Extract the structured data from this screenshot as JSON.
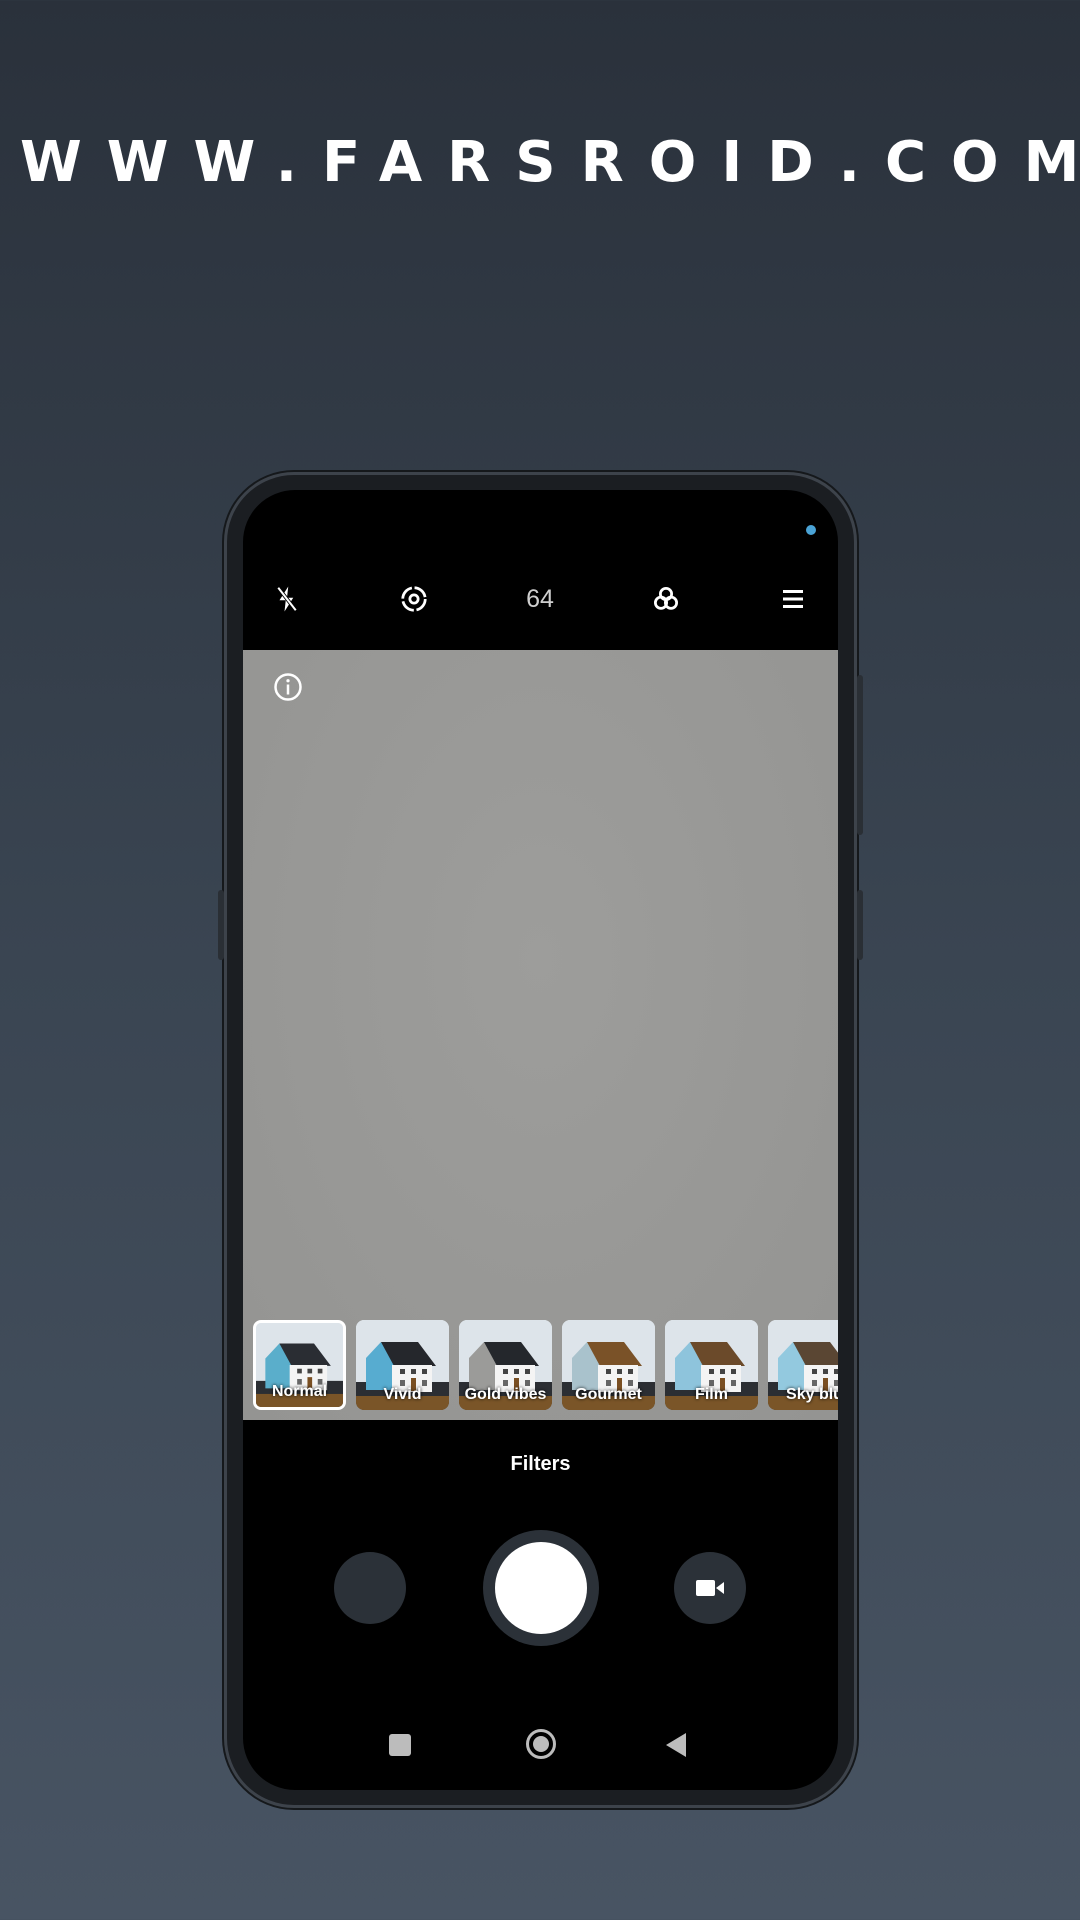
{
  "watermark": "WWW.FARSROID.COM",
  "topbar": {
    "flash_icon": "flash-off-icon",
    "hdr_icon": "lens-icon",
    "megapixels": "64",
    "filters_icon": "filters-icon",
    "menu_icon": "menu-icon"
  },
  "viewfinder": {
    "info_icon": "info-icon",
    "color": "#9a9a98"
  },
  "filters": {
    "items": [
      {
        "label": "Normal",
        "selected": true,
        "wall": "#5aaecb",
        "roof": "#2a2d33"
      },
      {
        "label": "Vivid",
        "selected": false,
        "wall": "#57acd0",
        "roof": "#25272c"
      },
      {
        "label": "Gold vibes",
        "selected": false,
        "wall": "#9b9b99",
        "roof": "#24272c"
      },
      {
        "label": "Gourmet",
        "selected": false,
        "wall": "#a9c2cc",
        "roof": "#7a5228"
      },
      {
        "label": "Film",
        "selected": false,
        "wall": "#8ec4dc",
        "roof": "#6b4a2a"
      },
      {
        "label": "Sky blu",
        "selected": false,
        "wall": "#93c9df",
        "roof": "#5a4633"
      }
    ],
    "title": "Filters"
  },
  "controls": {
    "gallery_icon": "gallery-thumbnail",
    "shutter_icon": "shutter-button",
    "video_icon": "video-camera-icon"
  },
  "navbar": {
    "recents_icon": "square-icon",
    "home_icon": "home-circle-icon",
    "back_icon": "back-triangle-icon"
  }
}
